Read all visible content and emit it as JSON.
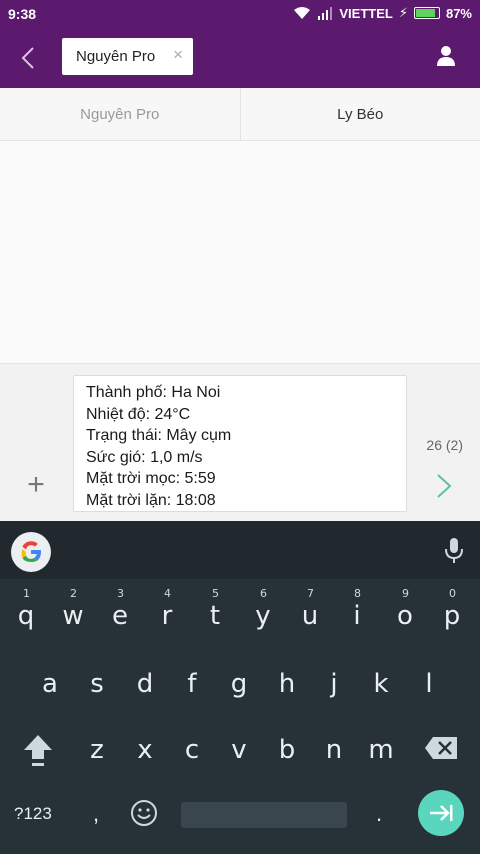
{
  "status_bar": {
    "time": "9:38",
    "carrier": "VIETTEL",
    "battery": "87%",
    "battery_level": 0.87
  },
  "header": {
    "recipient": "Nguyên Pro",
    "chip_close": "×"
  },
  "sim_tabs": [
    "Nguyên Pro",
    "Ly Béo"
  ],
  "compose": {
    "lines": [
      "Thành phố: Ha Noi",
      "Nhiệt độ: 24°C",
      "Trạng thái: Mây cụm",
      "Sức gió: 1,0 m/s",
      "Mặt trời mọc: 5:59",
      "Mặt trời lặn: 18:08"
    ],
    "char_count": "26 (2)",
    "attach": "+"
  },
  "keyboard": {
    "row1": [
      "q",
      "w",
      "e",
      "r",
      "t",
      "y",
      "u",
      "i",
      "o",
      "p"
    ],
    "row1_hints": [
      "1",
      "2",
      "3",
      "4",
      "5",
      "6",
      "7",
      "8",
      "9",
      "0"
    ],
    "row2": [
      "a",
      "s",
      "d",
      "f",
      "g",
      "h",
      "j",
      "k",
      "l"
    ],
    "row3": [
      "z",
      "x",
      "c",
      "v",
      "b",
      "n",
      "m"
    ],
    "symbols_key": "?123",
    "comma": ",",
    "period": "."
  },
  "colors": {
    "header_bg": "#5c1a6e",
    "keyboard_bg": "#263238",
    "enter_accent": "#5bd6be"
  }
}
